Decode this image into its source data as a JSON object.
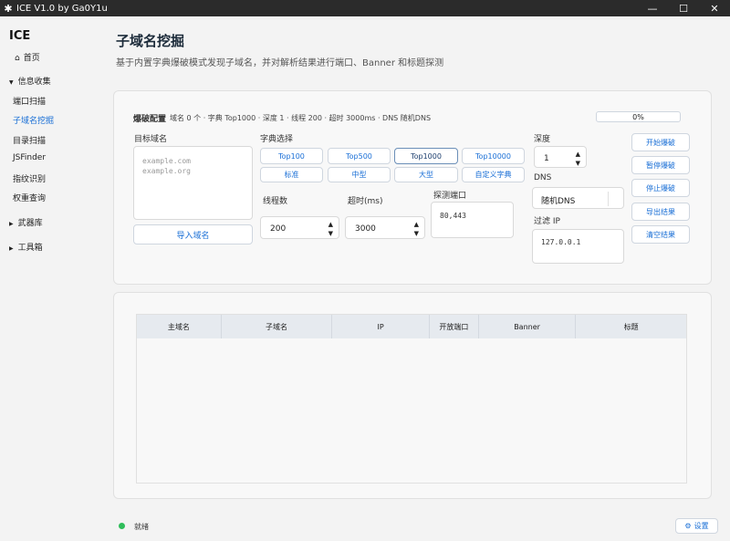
{
  "window": {
    "title": "ICE V1.0 by Ga0Y1u",
    "minimize": "—",
    "maximize": "☐",
    "close": "✕"
  },
  "sidebar": {
    "logo": "ICE",
    "home": "首页",
    "groups": {
      "info": "信息收集",
      "arsenal": "武器库",
      "toolbox": "工具箱"
    },
    "items": [
      "端口扫描",
      "子域名挖掘",
      "目录扫描",
      "JSFinder",
      "指纹识别",
      "权重查询"
    ]
  },
  "page": {
    "title": "子域名挖掘",
    "subtitle": "基于内置字典爆破模式发现子域名，并对解析结果进行端口、Banner 和标题探测"
  },
  "config": {
    "heading": "爆破配置",
    "summary": "域名 0 个 · 字典 Top1000 · 深度 1 · 线程 200 · 超时 3000ms · DNS 随机DNS",
    "progress": "0%",
    "target_label": "目标域名",
    "target_placeholder": "example.com\nexample.org",
    "import_button": "导入域名",
    "dict_label": "字典选择",
    "dicts": [
      "Top100",
      "Top500",
      "Top1000",
      "Top10000",
      "标准",
      "中型",
      "大型",
      "自定义字典"
    ],
    "threads_label": "线程数",
    "threads_value": "200",
    "timeout_label": "超时(ms)",
    "timeout_value": "3000",
    "ports_label": "探测端口",
    "ports_value": "80,443",
    "depth_label": "深度",
    "depth_value": "1",
    "dns_label": "DNS",
    "dns_value": "随机DNS",
    "filter_label": "过滤 IP",
    "filter_value": "127.0.0.1"
  },
  "actions": [
    "开始爆破",
    "暂停爆破",
    "停止爆破",
    "导出结果",
    "清空结果"
  ],
  "table": {
    "columns": [
      "主域名",
      "子域名",
      "IP",
      "开放端口",
      "Banner",
      "标题"
    ]
  },
  "status": {
    "text": "就绪",
    "settings": "设置"
  },
  "colors": {
    "accent": "#1a6fd6",
    "status_ok": "#2fbd5a",
    "titlebar": "#2b2b2b"
  }
}
